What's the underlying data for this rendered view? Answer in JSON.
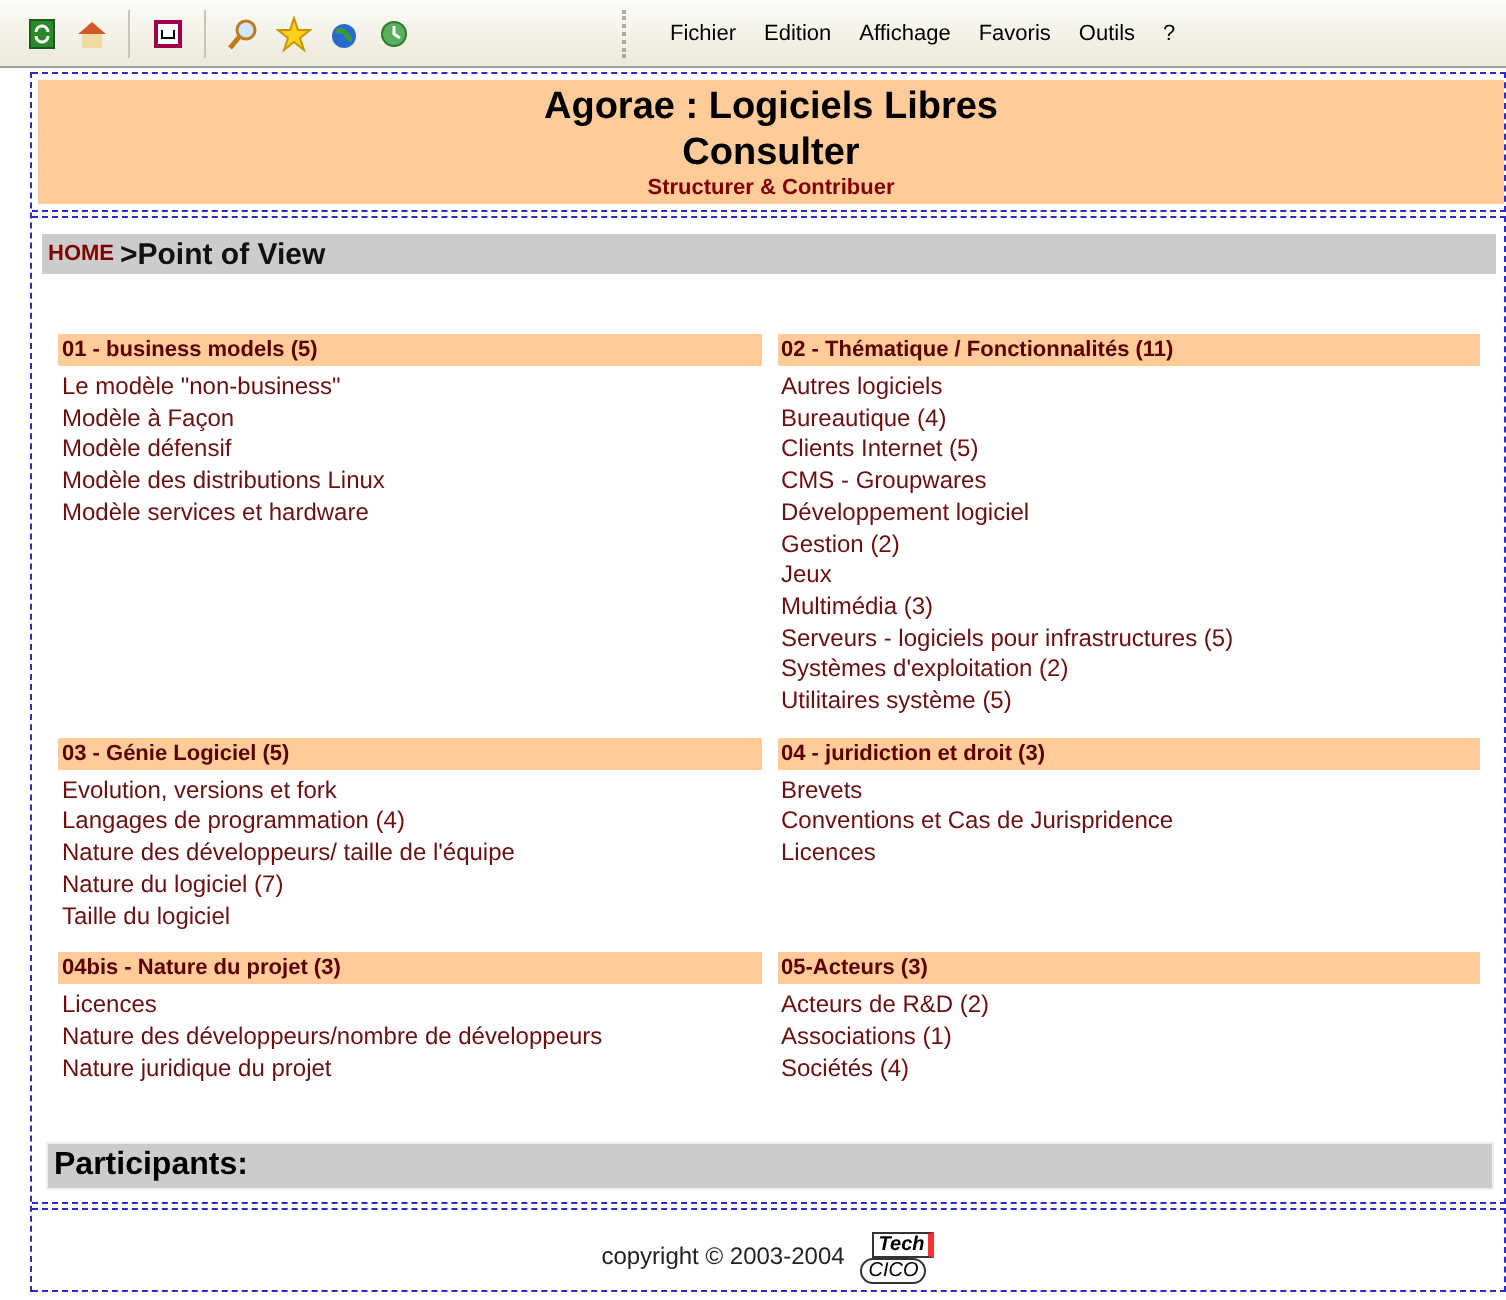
{
  "toolbar": {
    "menu": [
      "Fichier",
      "Edition",
      "Affichage",
      "Favoris",
      "Outils",
      "?"
    ]
  },
  "header": {
    "title": "Agorae : Logiciels Libres",
    "subtitle": "Consulter",
    "tagline": "Structurer & Contribuer"
  },
  "breadcrumb": {
    "home": "HOME",
    "current": ">Point of View"
  },
  "sections": [
    {
      "title": "01 - business models (5)",
      "items": [
        "Le modèle \"non-business\"",
        "Modèle à Façon",
        "Modèle défensif",
        "Modèle des distributions Linux",
        "Modèle services et hardware"
      ]
    },
    {
      "title": "02 - Thématique / Fonctionnalités (11)",
      "items": [
        "Autres logiciels",
        "Bureautique (4)",
        "Clients Internet (5)",
        "CMS - Groupwares",
        "Développement logiciel",
        "Gestion (2)",
        "Jeux",
        "Multimédia (3)",
        "Serveurs - logiciels pour infrastructures (5)",
        "Systèmes d'exploitation (2)",
        "Utilitaires système (5)"
      ]
    },
    {
      "title": "03 - Génie Logiciel (5)",
      "items": [
        "Evolution, versions et fork",
        "Langages de programmation (4)",
        "Nature des développeurs/ taille de l'équipe",
        "Nature du logiciel (7)",
        "Taille du logiciel"
      ]
    },
    {
      "title": "04 - juridiction et droit (3)",
      "items": [
        "Brevets",
        "Conventions et Cas de Jurispridence",
        "Licences"
      ]
    },
    {
      "title": "04bis - Nature du projet (3)",
      "items": [
        "Licences",
        "Nature des développeurs/nombre de développeurs",
        "Nature juridique du projet"
      ]
    },
    {
      "title": "05-Acteurs (3)",
      "items": [
        "Acteurs de R&D (2)",
        "Associations (1)",
        "Sociétés (4)"
      ]
    }
  ],
  "participants": {
    "label": "Participants:"
  },
  "footer": {
    "copyright": "copyright © 2003-2004",
    "logo_top": "Tech",
    "logo_bottom": "CICO"
  }
}
